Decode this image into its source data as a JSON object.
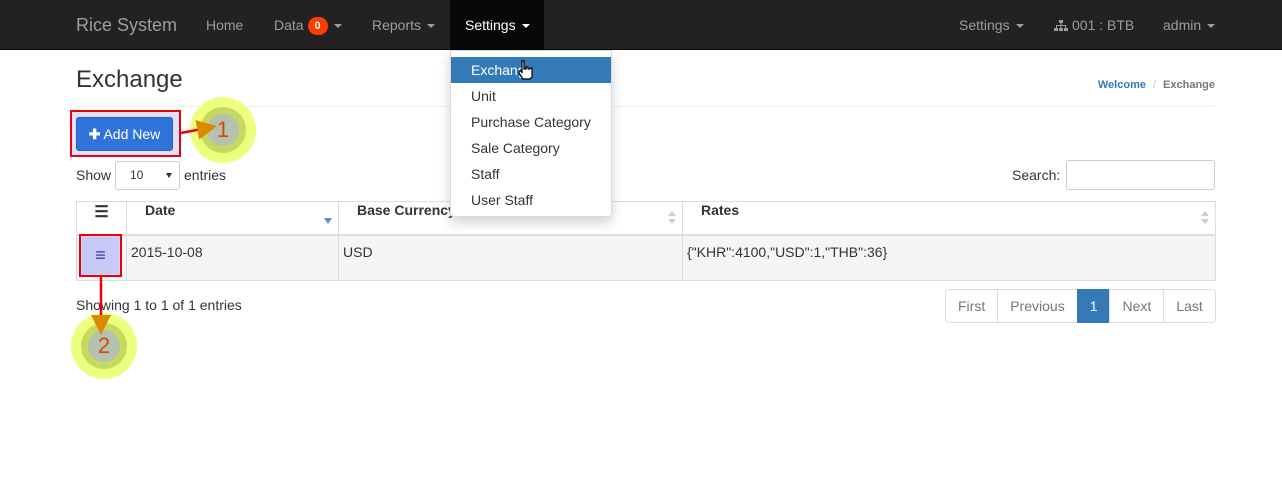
{
  "navbar": {
    "brand": "Rice System",
    "items": [
      {
        "label": "Home"
      },
      {
        "label": "Data",
        "badge": "0"
      },
      {
        "label": "Reports"
      },
      {
        "label": "Settings"
      }
    ],
    "right": {
      "settings_label": "Settings",
      "branch_label": "001 : BTB",
      "user_label": "admin"
    }
  },
  "dropdown": {
    "items": [
      "Exchange",
      "Unit",
      "Purchase Category",
      "Sale Category",
      "Staff",
      "User Staff"
    ],
    "active_item": "Exchange"
  },
  "page": {
    "title": "Exchange",
    "breadcrumb": {
      "home": "Welcome",
      "sep": "/",
      "current": "Exchange"
    }
  },
  "toolbar": {
    "add_new_label": "Add New"
  },
  "table_controls": {
    "show_label": "Show",
    "length_value": "10",
    "entries_label": "entries",
    "search_label": "Search:"
  },
  "table": {
    "menu_header_icon": "menu-icon",
    "columns": [
      "Date",
      "Base Currency",
      "Rates"
    ],
    "sorted_column": "Date",
    "sort_direction": "desc",
    "rows": [
      {
        "date": "2015-10-08",
        "base_currency": "USD",
        "rates": "{\"KHR\":4100,\"USD\":1,\"THB\":36}"
      }
    ]
  },
  "footer": {
    "info": "Showing 1 to 1 of 1 entries",
    "pagination": {
      "first": "First",
      "previous": "Previous",
      "current": "1",
      "next": "Next",
      "last": "Last"
    }
  },
  "annotations": {
    "marker_1": "1",
    "marker_2": "2"
  },
  "colors": {
    "navbar_bg": "#222222",
    "primary": "#337ab7",
    "add_button": "#3174d9",
    "badge": "#ff3b00",
    "annotation_red": "#e8000b",
    "annotation_yellow": "#eeff7e"
  }
}
